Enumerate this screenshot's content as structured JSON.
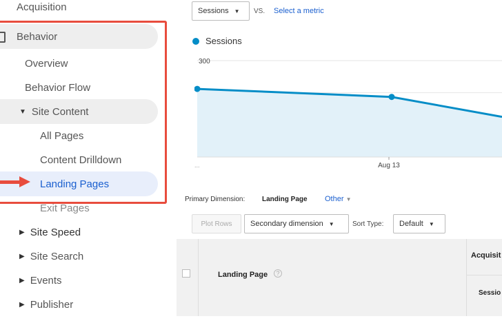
{
  "sidebar": {
    "items": [
      {
        "label": "Acquisition"
      },
      {
        "label": "Behavior"
      },
      {
        "label": "Overview"
      },
      {
        "label": "Behavior Flow"
      },
      {
        "label": "Site Content"
      },
      {
        "label": "All Pages"
      },
      {
        "label": "Content Drilldown"
      },
      {
        "label": "Landing Pages"
      },
      {
        "label": "Exit Pages"
      },
      {
        "label": "Site Speed"
      },
      {
        "label": "Site Search"
      },
      {
        "label": "Events"
      },
      {
        "label": "Publisher"
      }
    ]
  },
  "toolbar": {
    "metric_select": "Sessions",
    "vs_label": "VS.",
    "select_metric_link": "Select a metric"
  },
  "chart_data": {
    "type": "area",
    "series": [
      {
        "name": "Sessions",
        "color": "#058dc7",
        "values": [
          212,
          187,
          125
        ]
      }
    ],
    "x_labels": [
      "Aug 13"
    ],
    "ytick_labels": [
      "300",
      "200",
      "100"
    ],
    "ylim": [
      0,
      300
    ],
    "grid": true,
    "legend": "top-left"
  },
  "primary_dimension": {
    "label": "Primary Dimension:",
    "value": "Landing Page",
    "other": "Other"
  },
  "table_toolbar": {
    "plot_rows": "Plot Rows",
    "secondary_dimension": "Secondary dimension",
    "sort_type_label": "Sort Type:",
    "sort_type_value": "Default"
  },
  "table": {
    "landing_page_header": "Landing Page",
    "help": "?",
    "acquisition_header": "Acquisit",
    "sessions_header": "Sessio"
  }
}
